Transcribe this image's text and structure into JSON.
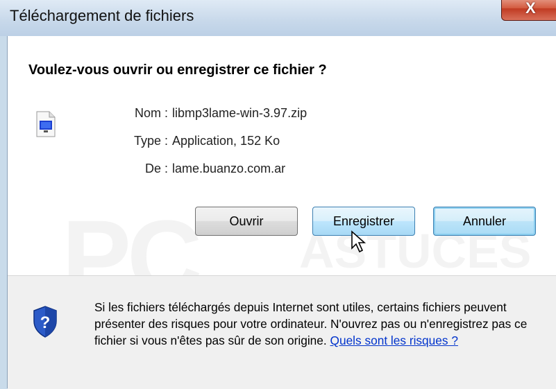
{
  "window": {
    "title": "Téléchargement de fichiers",
    "close_label": "X"
  },
  "dialog": {
    "question": "Voulez-vous ouvrir ou enregistrer ce fichier ?",
    "file": {
      "name_label": "Nom :",
      "name_value": "libmp3lame-win-3.97.zip",
      "type_label": "Type :",
      "type_value": "Application, 152 Ko",
      "from_label": "De :",
      "from_value": "lame.buanzo.com.ar"
    },
    "buttons": {
      "open": "Ouvrir",
      "save": "Enregistrer",
      "cancel": "Annuler"
    },
    "warning": {
      "text": "Si les fichiers téléchargés depuis Internet sont utiles, certains fichiers peuvent présenter des risques pour votre ordinateur. N'ouvrez pas ou n'enregistrez pas ce fichier si vous n'êtes pas sûr de son origine.",
      "link": "Quels sont les risques ?"
    }
  },
  "watermark": {
    "line1": "PC",
    "line2": "ASTUCES"
  },
  "icons": {
    "file": "file-icon",
    "shield": "shield-help-icon",
    "cursor": "mouse-pointer-icon"
  }
}
